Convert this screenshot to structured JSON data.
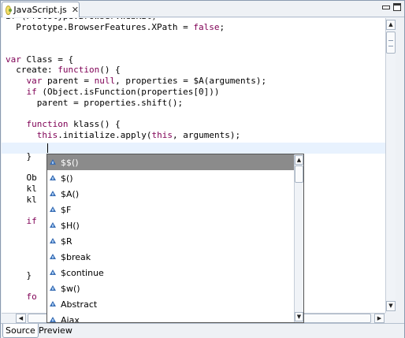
{
  "tab": {
    "label": "JavaScript.js",
    "close": "✕"
  },
  "code_lines": [
    [
      {
        "t": "if (Prototype.Browser.WebKit)"
      }
    ],
    [
      {
        "t": "  Prototype.BrowserFeatures.XPath = "
      },
      {
        "t": "false",
        "k": 1
      },
      {
        "t": ";"
      }
    ],
    [
      {
        "t": ""
      }
    ],
    [
      {
        "t": ""
      }
    ],
    [
      {
        "t": "var",
        "k": 1
      },
      {
        "t": " Class = {"
      }
    ],
    [
      {
        "t": "  create: "
      },
      {
        "t": "function",
        "k": 1
      },
      {
        "t": "() {"
      }
    ],
    [
      {
        "t": "    "
      },
      {
        "t": "var",
        "k": 1
      },
      {
        "t": " parent = "
      },
      {
        "t": "null",
        "k": 1
      },
      {
        "t": ", properties = $A(arguments);"
      }
    ],
    [
      {
        "t": "    "
      },
      {
        "t": "if",
        "k": 1
      },
      {
        "t": " (Object.isFunction(properties[0]))"
      }
    ],
    [
      {
        "t": "      parent = properties.shift();"
      }
    ],
    [
      {
        "t": ""
      }
    ],
    [
      {
        "t": "    "
      },
      {
        "t": "function",
        "k": 1
      },
      {
        "t": " klass() {"
      }
    ],
    [
      {
        "t": "      "
      },
      {
        "t": "this",
        "k": 1
      },
      {
        "t": ".initialize.apply("
      },
      {
        "t": "this",
        "k": 1
      },
      {
        "t": ", arguments);"
      }
    ],
    [
      {
        "t": ""
      }
    ],
    [
      {
        "t": "    }"
      }
    ],
    [
      {
        "t": ""
      }
    ],
    [
      {
        "t": "    Ob"
      }
    ],
    [
      {
        "t": "    kl"
      }
    ],
    [
      {
        "t": "    kl"
      }
    ],
    [
      {
        "t": ""
      }
    ],
    [
      {
        "t": "    "
      },
      {
        "t": "if",
        "k": 1
      }
    ],
    [
      {
        "t": ""
      }
    ],
    [
      {
        "t": ""
      }
    ],
    [
      {
        "t": ""
      }
    ],
    [
      {
        "t": ""
      }
    ],
    [
      {
        "t": "    }"
      }
    ],
    [
      {
        "t": ""
      }
    ],
    [
      {
        "t": "    "
      },
      {
        "t": "fo",
        "k": 1
      }
    ]
  ],
  "autocomplete": {
    "items": [
      "$$()",
      "$()",
      "$A()",
      "$F",
      "$H()",
      "$R",
      "$break",
      "$continue",
      "$w()",
      "Abstract",
      "Ajax"
    ],
    "selected_index": 0
  },
  "bottom_tabs": {
    "source": "Source",
    "preview": "Preview"
  },
  "colors": {
    "keyword": "#7f0055",
    "current_line": "#e8f2fe",
    "selection": "#8b8b8b"
  }
}
